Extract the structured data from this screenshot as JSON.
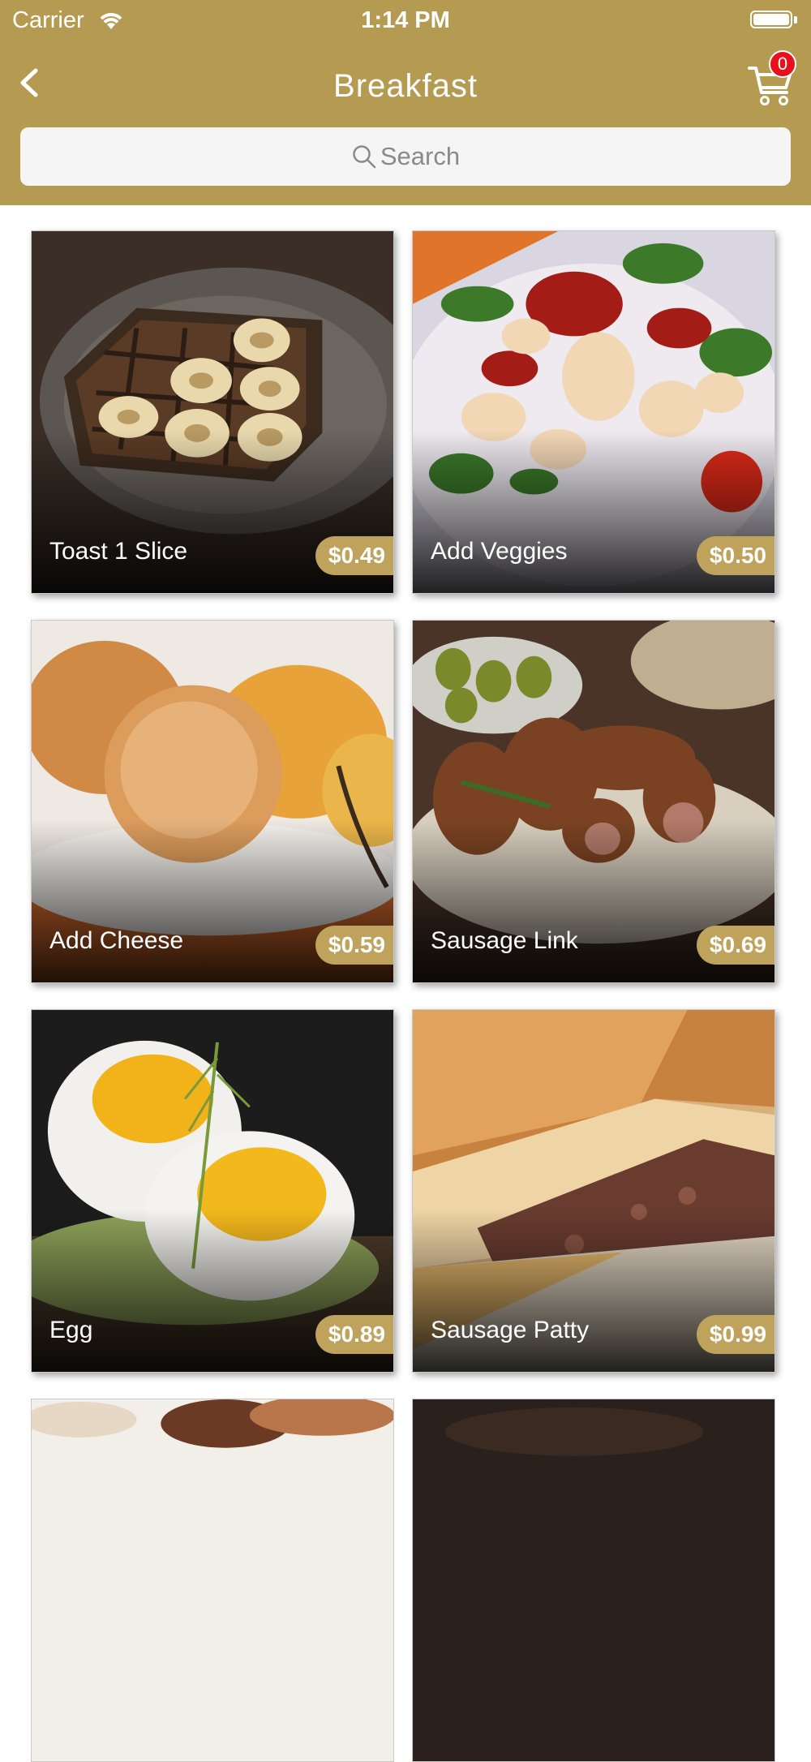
{
  "status_bar": {
    "carrier": "Carrier",
    "time": "1:14 PM"
  },
  "nav": {
    "title": "Breakfast",
    "cart_count": "0"
  },
  "search": {
    "placeholder": "Search"
  },
  "items": [
    {
      "name": "Toast 1 Slice",
      "price": "$0.49"
    },
    {
      "name": "Add Veggies",
      "price": "$0.50"
    },
    {
      "name": "Add Cheese",
      "price": "$0.59"
    },
    {
      "name": "Sausage Link",
      "price": "$0.69"
    },
    {
      "name": "Egg",
      "price": "$0.89"
    },
    {
      "name": "Sausage Patty",
      "price": "$0.99"
    }
  ],
  "colors": {
    "header": "#b59a52",
    "price_tag": "#bfa35c",
    "badge": "#e8101a"
  }
}
